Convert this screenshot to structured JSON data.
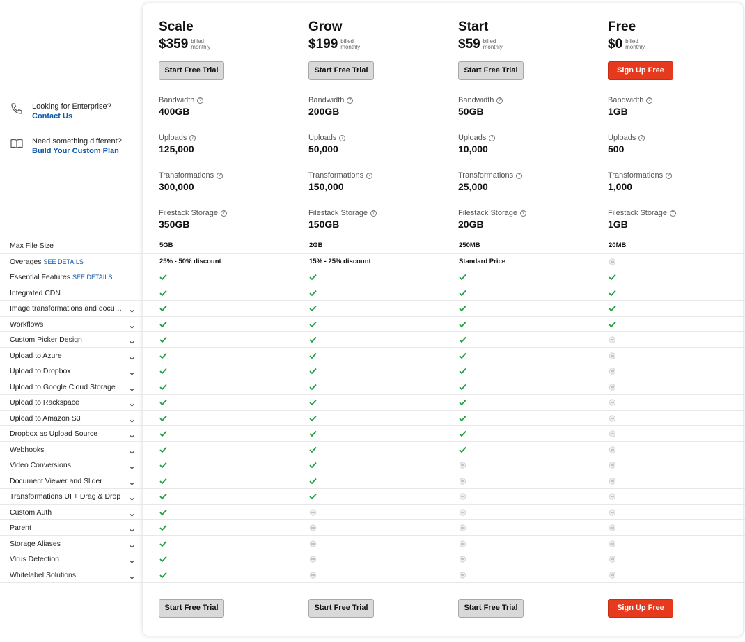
{
  "plans": [
    {
      "name": "Scale",
      "price": "$359",
      "billed_line1": "billed",
      "billed_line2": "monthly",
      "button": "Start Free Trial",
      "button_style": "gray",
      "bandwidth": "400GB",
      "uploads": "125,000",
      "transformations": "300,000",
      "storage": "350GB"
    },
    {
      "name": "Grow",
      "price": "$199",
      "billed_line1": "billed",
      "billed_line2": "monthly",
      "button": "Start Free Trial",
      "button_style": "gray",
      "bandwidth": "200GB",
      "uploads": "50,000",
      "transformations": "150,000",
      "storage": "150GB"
    },
    {
      "name": "Start",
      "price": "$59",
      "billed_line1": "billed",
      "billed_line2": "monthly",
      "button": "Start Free Trial",
      "button_style": "gray",
      "bandwidth": "50GB",
      "uploads": "10,000",
      "transformations": "25,000",
      "storage": "20GB"
    },
    {
      "name": "Free",
      "price": "$0",
      "billed_line1": "billed",
      "billed_line2": "monthly",
      "button": "Sign Up Free",
      "button_style": "red",
      "bandwidth": "1GB",
      "uploads": "500",
      "transformations": "1,000",
      "storage": "1GB"
    }
  ],
  "metric_labels": {
    "bandwidth": "Bandwidth",
    "uploads": "Uploads",
    "transformations": "Transformations",
    "storage": "Filestack Storage"
  },
  "sidebar": {
    "enterprise_text": "Looking for Enterprise?",
    "enterprise_link": "Contact Us",
    "custom_text": "Need something different?",
    "custom_link": "Build Your Custom Plan"
  },
  "see_details": "SEE DETAILS",
  "features": [
    {
      "label": "Max File Size",
      "expand": false,
      "cells": [
        "5GB",
        "2GB",
        "250MB",
        "20MB"
      ]
    },
    {
      "label": "Overages",
      "see_details": true,
      "expand": false,
      "cells": [
        "25% - 50% discount",
        "15% - 25% discount",
        "Standard Price",
        "dash"
      ]
    },
    {
      "label": "Essential Features",
      "see_details": true,
      "expand": false,
      "cells": [
        "check",
        "check",
        "check",
        "check"
      ]
    },
    {
      "label": "Integrated CDN",
      "expand": false,
      "cells": [
        "check",
        "check",
        "check",
        "check"
      ]
    },
    {
      "label": "Image transformations and document conversions",
      "expand": true,
      "cells": [
        "check",
        "check",
        "check",
        "check"
      ]
    },
    {
      "label": "Workflows",
      "expand": true,
      "cells": [
        "check",
        "check",
        "check",
        "check"
      ]
    },
    {
      "label": "Custom Picker Design",
      "expand": true,
      "cells": [
        "check",
        "check",
        "check",
        "dash"
      ]
    },
    {
      "label": "Upload to Azure",
      "expand": true,
      "cells": [
        "check",
        "check",
        "check",
        "dash"
      ]
    },
    {
      "label": "Upload to Dropbox",
      "expand": true,
      "cells": [
        "check",
        "check",
        "check",
        "dash"
      ]
    },
    {
      "label": "Upload to Google Cloud Storage",
      "expand": true,
      "cells": [
        "check",
        "check",
        "check",
        "dash"
      ]
    },
    {
      "label": "Upload to Rackspace",
      "expand": true,
      "cells": [
        "check",
        "check",
        "check",
        "dash"
      ]
    },
    {
      "label": "Upload to Amazon S3",
      "expand": true,
      "cells": [
        "check",
        "check",
        "check",
        "dash"
      ]
    },
    {
      "label": "Dropbox as Upload Source",
      "expand": true,
      "cells": [
        "check",
        "check",
        "check",
        "dash"
      ]
    },
    {
      "label": "Webhooks",
      "expand": true,
      "cells": [
        "check",
        "check",
        "check",
        "dash"
      ]
    },
    {
      "label": "Video Conversions",
      "expand": true,
      "cells": [
        "check",
        "check",
        "dash",
        "dash"
      ]
    },
    {
      "label": "Document Viewer and Slider",
      "expand": true,
      "cells": [
        "check",
        "check",
        "dash",
        "dash"
      ]
    },
    {
      "label": "Transformations UI + Drag & Drop",
      "expand": true,
      "cells": [
        "check",
        "check",
        "dash",
        "dash"
      ]
    },
    {
      "label": "Custom Auth",
      "expand": true,
      "cells": [
        "check",
        "dash",
        "dash",
        "dash"
      ]
    },
    {
      "label": "Parent",
      "expand": true,
      "cells": [
        "check",
        "dash",
        "dash",
        "dash"
      ]
    },
    {
      "label": "Storage Aliases",
      "expand": true,
      "cells": [
        "check",
        "dash",
        "dash",
        "dash"
      ]
    },
    {
      "label": "Virus Detection",
      "expand": true,
      "cells": [
        "check",
        "dash",
        "dash",
        "dash"
      ]
    },
    {
      "label": "Whitelabel Solutions",
      "expand": true,
      "cells": [
        "check",
        "dash",
        "dash",
        "dash"
      ]
    }
  ],
  "colors": {
    "accent_red": "#e63a1e",
    "link_blue": "#0b57a8",
    "check_green": "#1e9e3e"
  },
  "icons": {
    "enterprise": "phone-icon",
    "custom": "book-icon",
    "expand": "chevron-down-icon",
    "included": "check-icon",
    "excluded": "dash-icon",
    "info": "info-icon"
  }
}
